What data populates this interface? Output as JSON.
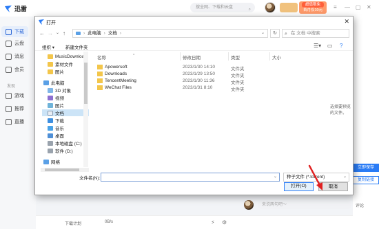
{
  "app": {
    "name": "迅雷",
    "search_placeholder": "搜全网、下载和云盘",
    "vip_promo_line1": "超值限免",
    "vip_promo_line2": "首月仅10元",
    "sidebar": [
      {
        "label": "下载",
        "active": true
      },
      {
        "label": "云盘"
      },
      {
        "label": "消息"
      },
      {
        "label": "会员"
      }
    ],
    "sidebar_section": "发现",
    "sidebar_discover": [
      {
        "label": "游戏"
      },
      {
        "label": "推荐"
      },
      {
        "label": "直播"
      }
    ],
    "right_panel": {
      "open_save": "立即保存",
      "copy_link": "复制链接"
    },
    "comment_placeholder": "来说两句吧～",
    "comment_label": "评论",
    "status_label": "下载计划",
    "status_speed": "0B/s"
  },
  "dialog": {
    "title": "打开",
    "address": [
      "此电脑",
      "文档"
    ],
    "search_placeholder": "在 文档 中搜索",
    "toolbar": {
      "organize": "组织",
      "new_folder": "新建文件夹"
    },
    "nav_items": [
      {
        "label": "MusicDownloa",
        "icon": "folder"
      },
      {
        "label": "素材文件",
        "icon": "folder"
      },
      {
        "label": "图片",
        "icon": "folder"
      },
      {
        "label": "此电脑",
        "icon": "pc"
      },
      {
        "label": "3D 对象",
        "icon": "3d"
      },
      {
        "label": "视频",
        "icon": "video"
      },
      {
        "label": "图片",
        "icon": "picture"
      },
      {
        "label": "文档",
        "icon": "document",
        "selected": true
      },
      {
        "label": "下载",
        "icon": "download"
      },
      {
        "label": "音乐",
        "icon": "music"
      },
      {
        "label": "桌面",
        "icon": "desktop"
      },
      {
        "label": "本地磁盘 (C:)",
        "icon": "drive"
      },
      {
        "label": "软件 (D:)",
        "icon": "drive"
      },
      {
        "label": "网络",
        "icon": "network"
      }
    ],
    "columns": {
      "name": "名称",
      "modified": "修改日期",
      "type": "类型",
      "size": "大小"
    },
    "files": [
      {
        "name": "Apowersoft",
        "modified": "2023/1/30 14:10",
        "type": "文件夹"
      },
      {
        "name": "Downloads",
        "modified": "2023/1/29 13:50",
        "type": "文件夹"
      },
      {
        "name": "TencentMeeting",
        "modified": "2023/1/30 11:36",
        "type": "文件夹"
      },
      {
        "name": "WeChat Files",
        "modified": "2023/1/31 8:10",
        "type": "文件夹"
      }
    ],
    "preview_hint": "选择要预览的文件。",
    "filename_label": "文件名(N):",
    "filename_value": "",
    "filetype": "种子文件 (*.torrent)",
    "open_button": "打开(O)",
    "cancel_button": "取消"
  },
  "colors": {
    "accent": "#2a7cf6",
    "folder": "#f3c64b",
    "selection": "#cce4f7",
    "annotation_arrow": "#e02020"
  }
}
